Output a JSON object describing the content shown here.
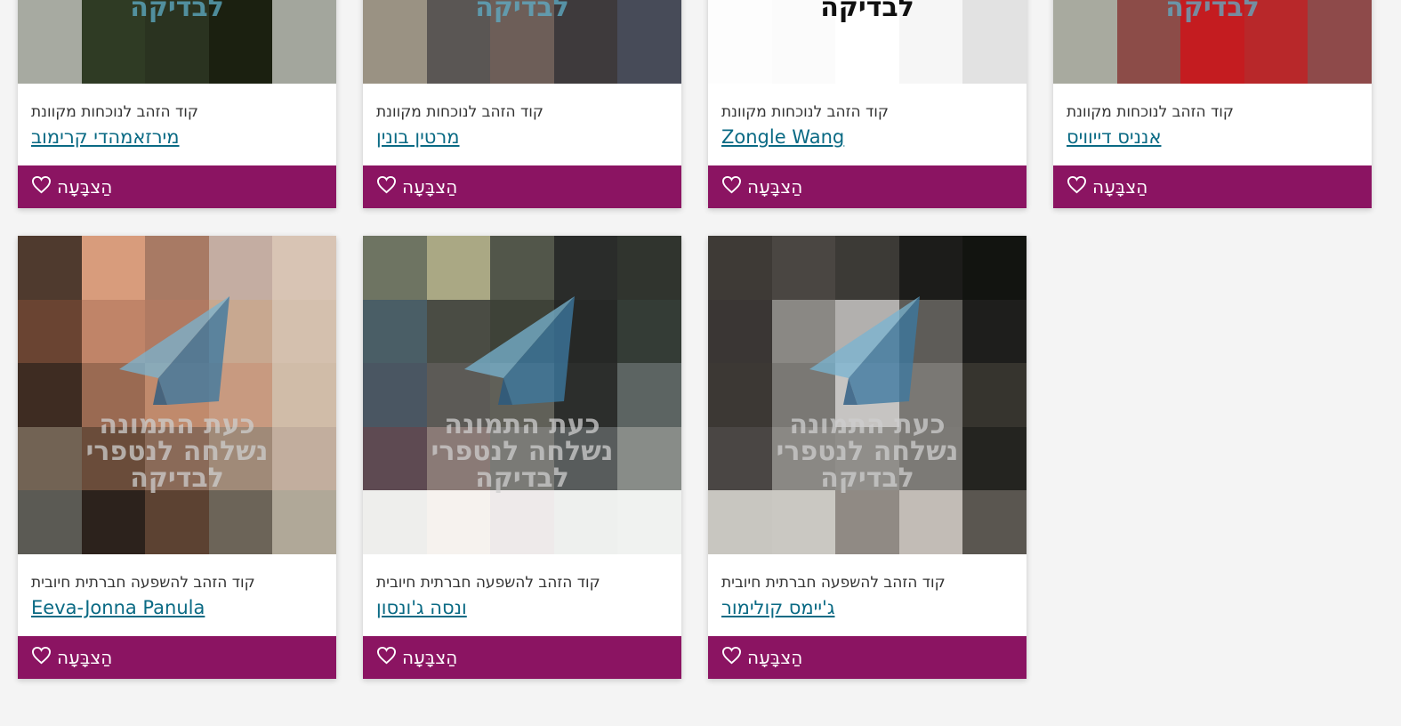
{
  "theme": {
    "vote_bg": "#8b1462",
    "link_color": "#0a6a84",
    "page_bg": "#f4f4f4"
  },
  "overlay_text": {
    "line1": "כעת התמונה",
    "line2": "נשלחה לנטפרי",
    "line3": "לבדיקה"
  },
  "cards": [
    {
      "category": "קוד הזהב לנוכחות מקוונת",
      "name": "מירזאמהדי קרימוב",
      "vote_label": "הַצבָּעָה",
      "icon": "heart-icon",
      "tiles": [
        "#a7aaa1",
        "#2f3b24",
        "#2a3320",
        "#1b2010",
        "#a3a69d"
      ]
    },
    {
      "category": "קוד הזהב לנוכחות מקוונת",
      "name": "מרטין בונין",
      "vote_label": "הַצבָּעָה",
      "icon": "heart-icon",
      "tiles": [
        "#9a9283",
        "#5a5654",
        "#6d5e58",
        "#3e3a3c",
        "#474b58"
      ]
    },
    {
      "category": "קוד הזהב לנוכחות מקוונת",
      "name": "Zongle Wang",
      "vote_label": "הַצבָּעָה",
      "icon": "heart-icon",
      "tiles": [
        "#fdfdfd",
        "#fbfbfb",
        "#ffffff",
        "#f6f6f6",
        "#e2e2e2"
      ]
    },
    {
      "category": "קוד הזהב לנוכחות מקוונת",
      "name": "אנניס דייוויס",
      "vote_label": "הַצבָּעָה",
      "icon": "heart-icon",
      "tiles": [
        "#a8aa9f",
        "#8c4c48",
        "#c41c20",
        "#b8282a",
        "#8e4a4a"
      ]
    },
    {
      "category": "קוד הזהב להשפעה חברתית חיובית",
      "name": "Eeva-Jonna Panula",
      "vote_label": "הַצבָּעָה",
      "icon": "heart-icon",
      "tiles": [
        "#4f3a2e",
        "#d89c7c",
        "#a87a64",
        "#c4ada2",
        "#d8c4b4",
        "#6a4432",
        "#c08468",
        "#b07a62",
        "#c8a890",
        "#d4c0ae",
        "#3e2c22",
        "#9a6a52",
        "#c08a6c",
        "#c89a80",
        "#d0bca8",
        "#726354",
        "#6a4c3a",
        "#8a6a58",
        "#a08a78",
        "#c2ae9e",
        "#5b5a54",
        "#2c221c",
        "#5c4232",
        "#6c6458",
        "#b0a898"
      ]
    },
    {
      "category": "קוד הזהב להשפעה חברתית חיובית",
      "name": "ונסה ג'ונסון",
      "vote_label": "הַצבָּעָה",
      "icon": "heart-icon",
      "tiles": [
        "#6e7462",
        "#aaa884",
        "#52564a",
        "#2a2c2a",
        "#30342e",
        "#4a5e66",
        "#4a4c44",
        "#3e4238",
        "#262826",
        "#343c36",
        "#4a5662",
        "#5c5a56",
        "#606058",
        "#2c2e2c",
        "#5c6462",
        "#5e4a52",
        "#8a7a76",
        "#7a7a76",
        "#585c5c",
        "#888c88",
        "#eeeeec",
        "#f6f2ee",
        "#eeeaea",
        "#eef0ee",
        "#f0f2f0"
      ]
    },
    {
      "category": "קוד הזהב להשפעה חברתית חיובית",
      "name": "ג'יימס קולימור",
      "vote_label": "הַצבָּעָה",
      "icon": "heart-icon",
      "tiles": [
        "#3e3a36",
        "#4a4642",
        "#3c3a36",
        "#1c1c1a",
        "#121410",
        "#3a3634",
        "#8a8884",
        "#b2b0ae",
        "#5e5c58",
        "#1e1e1c",
        "#3c3834",
        "#7a7874",
        "#c6c4c2",
        "#7a7874",
        "#36342e",
        "#4a4644",
        "#8a8884",
        "#908e8a",
        "#7c7a76",
        "#242420",
        "#c8c6c0",
        "#cac8c2",
        "#908a84",
        "#c2bcb6",
        "#5a5650"
      ]
    }
  ]
}
